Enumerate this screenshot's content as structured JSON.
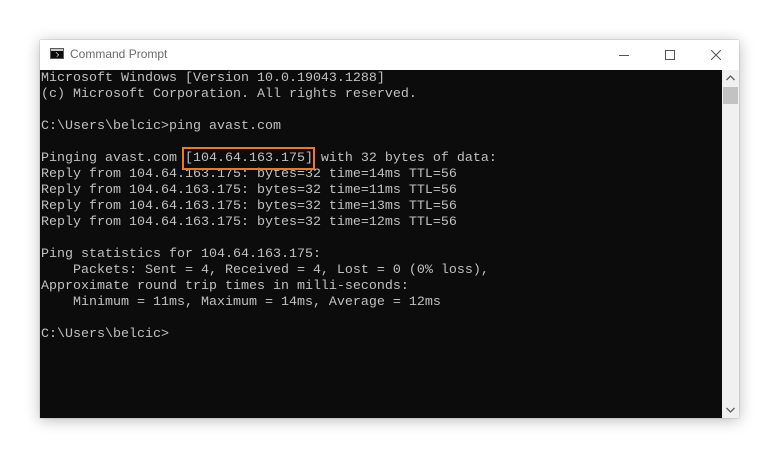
{
  "window": {
    "title": "Command Prompt",
    "icon": "cmd-icon",
    "controls": {
      "minimize": "minimize-icon",
      "maximize": "maximize-icon",
      "close": "close-icon"
    }
  },
  "console": {
    "lines": [
      "Microsoft Windows [Version 10.0.19043.1288]",
      "(c) Microsoft Corporation. All rights reserved.",
      "",
      "C:\\Users\\belcic>ping avast.com",
      "",
      "Pinging avast.com [104.64.163.175] with 32 bytes of data:",
      "Reply from 104.64.163.175: bytes=32 time=14ms TTL=56",
      "Reply from 104.64.163.175: bytes=32 time=11ms TTL=56",
      "Reply from 104.64.163.175: bytes=32 time=13ms TTL=56",
      "Reply from 104.64.163.175: bytes=32 time=12ms TTL=56",
      "",
      "Ping statistics for 104.64.163.175:",
      "    Packets: Sent = 4, Received = 4, Lost = 0 (0% loss),",
      "Approximate round trip times in milli-seconds:",
      "    Minimum = 11ms, Maximum = 14ms, Average = 12ms",
      "",
      "C:\\Users\\belcic>"
    ],
    "text_color": "#c0c0c0",
    "background_color": "#0c0c0c",
    "highlight": {
      "text": "[104.64.163.175]",
      "color": "#f07820"
    }
  },
  "scrollbar": {
    "up_icon": "scroll-up-arrow-icon",
    "down_icon": "scroll-down-arrow-icon"
  }
}
